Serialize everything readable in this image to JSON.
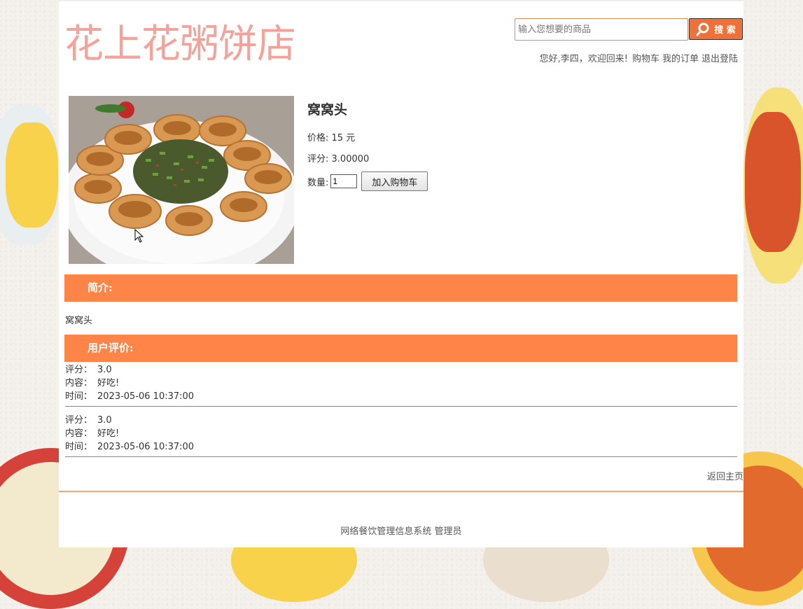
{
  "header": {
    "logo": "花上花粥饼店",
    "search": {
      "placeholder": "输入您想要的商品",
      "button_label": "搜 索"
    },
    "user_bar": {
      "greeting": "您好,李四，欢迎回来!",
      "cart_link": "购物车",
      "orders_link": "我的订单",
      "logout_link": "退出登陆"
    }
  },
  "product": {
    "name": "窝窝头",
    "price_label": "价格:",
    "price_value": "15 元",
    "rating_label": "评分:",
    "rating_value": "3.00000",
    "quantity_label": "数量:",
    "quantity_value": "1",
    "add_to_cart_label": "加入购物车"
  },
  "intro": {
    "heading": "简介:",
    "text": "窝窝头"
  },
  "reviews": {
    "heading": "用户评价:",
    "labels": {
      "rating": "评分：",
      "content": "内容：",
      "time": "时间："
    },
    "items": [
      {
        "rating": "3.0",
        "content": "好吃!",
        "time": "2023-05-06 10:37:00"
      },
      {
        "rating": "3.0",
        "content": "好吃!",
        "time": "2023-05-06 10:37:00"
      }
    ]
  },
  "back_link": "返回主页",
  "footer": {
    "text": "网络餐饮管理信息系统 管理员"
  },
  "colors": {
    "accent": "#ff8447",
    "logo": "#f3a39a",
    "search_button": "#f0703a"
  }
}
